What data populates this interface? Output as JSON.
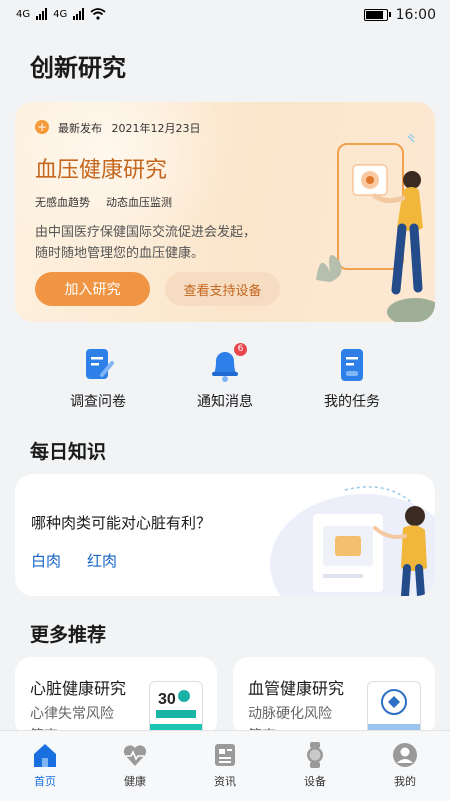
{
  "status_bar": {
    "signal1": "4G",
    "signal2": "4G",
    "time": "16:00"
  },
  "page": {
    "title": "创新研究"
  },
  "hero": {
    "release_label": "最新发布",
    "release_date": "2021年12月23日",
    "title": "血压健康研究",
    "tags": [
      "无感血趋势",
      "动态血压监测"
    ],
    "desc_line1": "由中国医疗保健国际交流促进会发起，",
    "desc_line2": "随时随地管理您的血压健康。",
    "join_button": "加入研究",
    "device_button": "查看支持设备"
  },
  "quick": {
    "items": [
      {
        "label": "调查问卷",
        "icon": "questionnaire-icon"
      },
      {
        "label": "通知消息",
        "icon": "bell-icon",
        "badge": "6"
      },
      {
        "label": "我的任务",
        "icon": "task-icon"
      }
    ]
  },
  "knowledge": {
    "section_title": "每日知识",
    "question": "哪种肉类可能对心脏有利？",
    "options": [
      "白肉",
      "红肉"
    ]
  },
  "recommend": {
    "section_title": "更多推荐",
    "cards": [
      {
        "title": "心脏健康研究",
        "sub1": "心律失常风险",
        "sub2": "筛查"
      },
      {
        "title": "血管健康研究",
        "sub1": "动脉硬化风险",
        "sub2": "筛查"
      }
    ]
  },
  "tabbar": {
    "tabs": [
      {
        "label": "首页",
        "icon": "home-icon",
        "active": true
      },
      {
        "label": "健康",
        "icon": "heart-pulse-icon"
      },
      {
        "label": "资讯",
        "icon": "news-icon"
      },
      {
        "label": "设备",
        "icon": "watch-icon"
      },
      {
        "label": "我的",
        "icon": "profile-icon"
      }
    ]
  },
  "colors": {
    "accent": "#ef9543",
    "link": "#1667c6",
    "active_tab": "#1a6fe0"
  }
}
